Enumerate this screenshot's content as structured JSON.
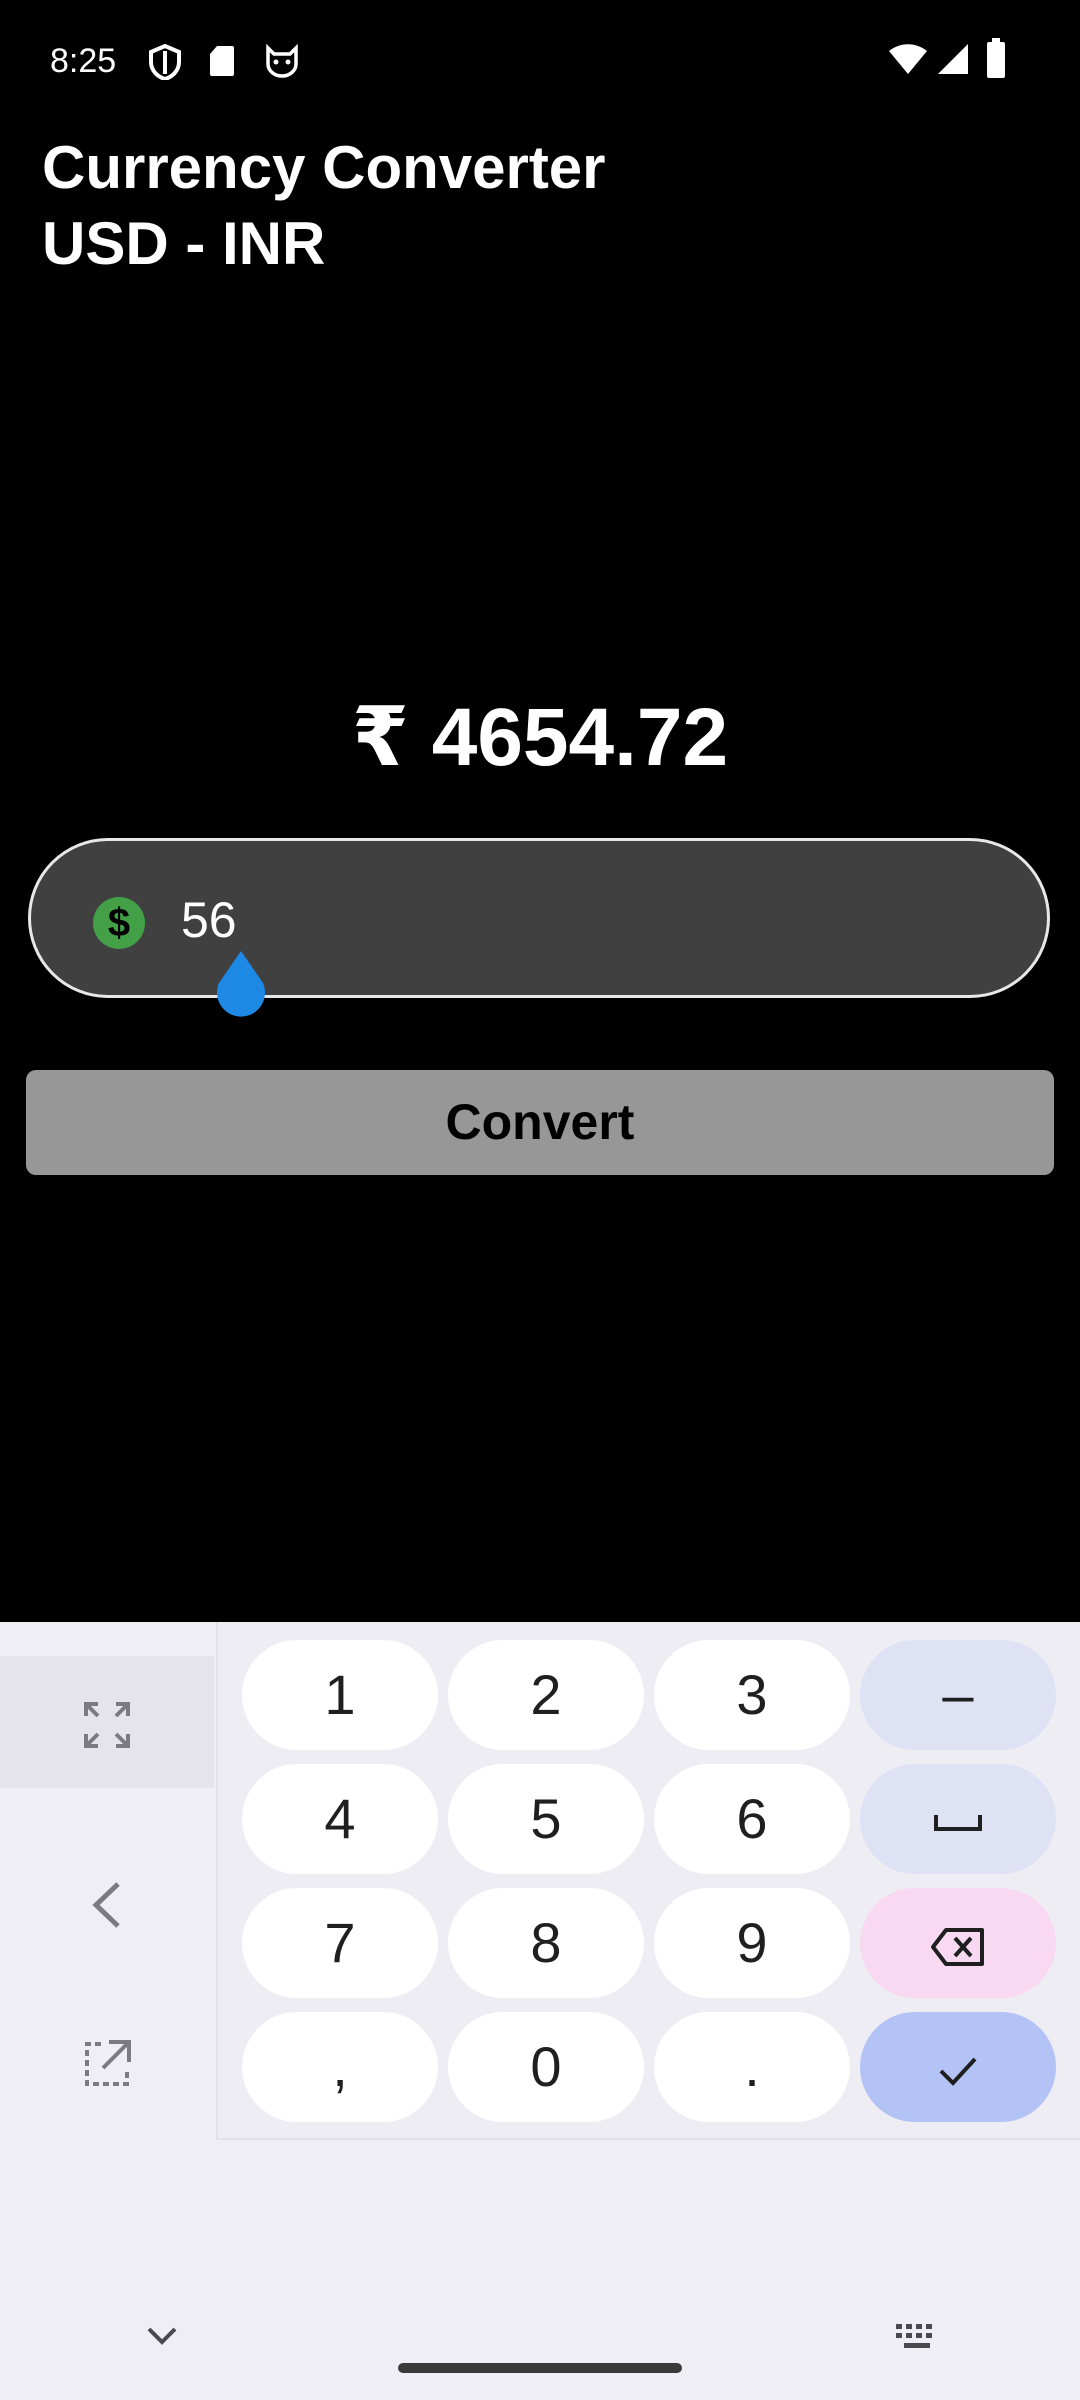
{
  "status_bar": {
    "time": "8:25"
  },
  "header": {
    "title_line1": "Currency Converter",
    "title_line2": "USD - INR"
  },
  "result": {
    "text": "₹ 4654.72"
  },
  "input": {
    "value": "56",
    "icon": "dollar-icon"
  },
  "convert_button": {
    "label": "Convert"
  },
  "keyboard": {
    "keys": [
      {
        "label": "1"
      },
      {
        "label": "2"
      },
      {
        "label": "3"
      },
      {
        "label": "–"
      },
      {
        "label": "4"
      },
      {
        "label": "5"
      },
      {
        "label": "6"
      },
      {
        "label": "space"
      },
      {
        "label": "7"
      },
      {
        "label": "8"
      },
      {
        "label": "9"
      },
      {
        "label": "backspace"
      },
      {
        "label": ","
      },
      {
        "label": "0"
      },
      {
        "label": "."
      },
      {
        "label": "done"
      }
    ],
    "colors": {
      "keypad_bg": "#eeedf4",
      "key": "#ffffff",
      "fn": "#dfe1f5",
      "del": "#f9d9f1",
      "done": "#b3c3f5"
    }
  }
}
